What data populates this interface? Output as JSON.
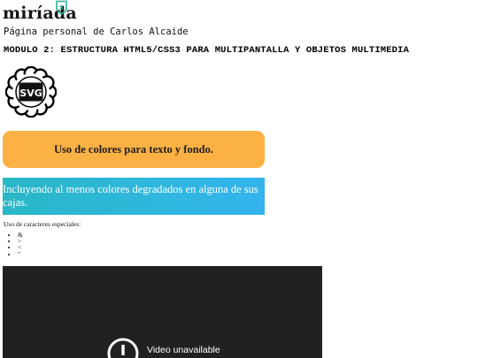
{
  "header": {
    "logo_text": "miríada",
    "logo_badge": "x",
    "subtitle": "Página personal de Carlos Alcaide",
    "module_title": "MODULO 2: ESTRUCTURA HTML5/CSS3 PARA MULTIPANTALLA Y OBJETOS MULTIMEDIA"
  },
  "badge": {
    "label": "SVG",
    "icon": "svg-badge-icon"
  },
  "boxes": {
    "orange_text": "Uso de colores para texto y fondo.",
    "gradient_text": "Incluyendo al menos colores degradados en alguna de sus cajas."
  },
  "special_chars": {
    "label": "Uso de caracteres especiales:",
    "items": [
      "&",
      ">",
      "<",
      "\""
    ]
  },
  "video": {
    "message": "Video unavailable",
    "icon": "alert-circle-icon"
  },
  "colors": {
    "orange_box": "#fbb143",
    "gradient_start": "#29b7c6",
    "gradient_end": "#34b3ee",
    "logo_badge": "#2bb39b",
    "video_bg": "#212121"
  }
}
